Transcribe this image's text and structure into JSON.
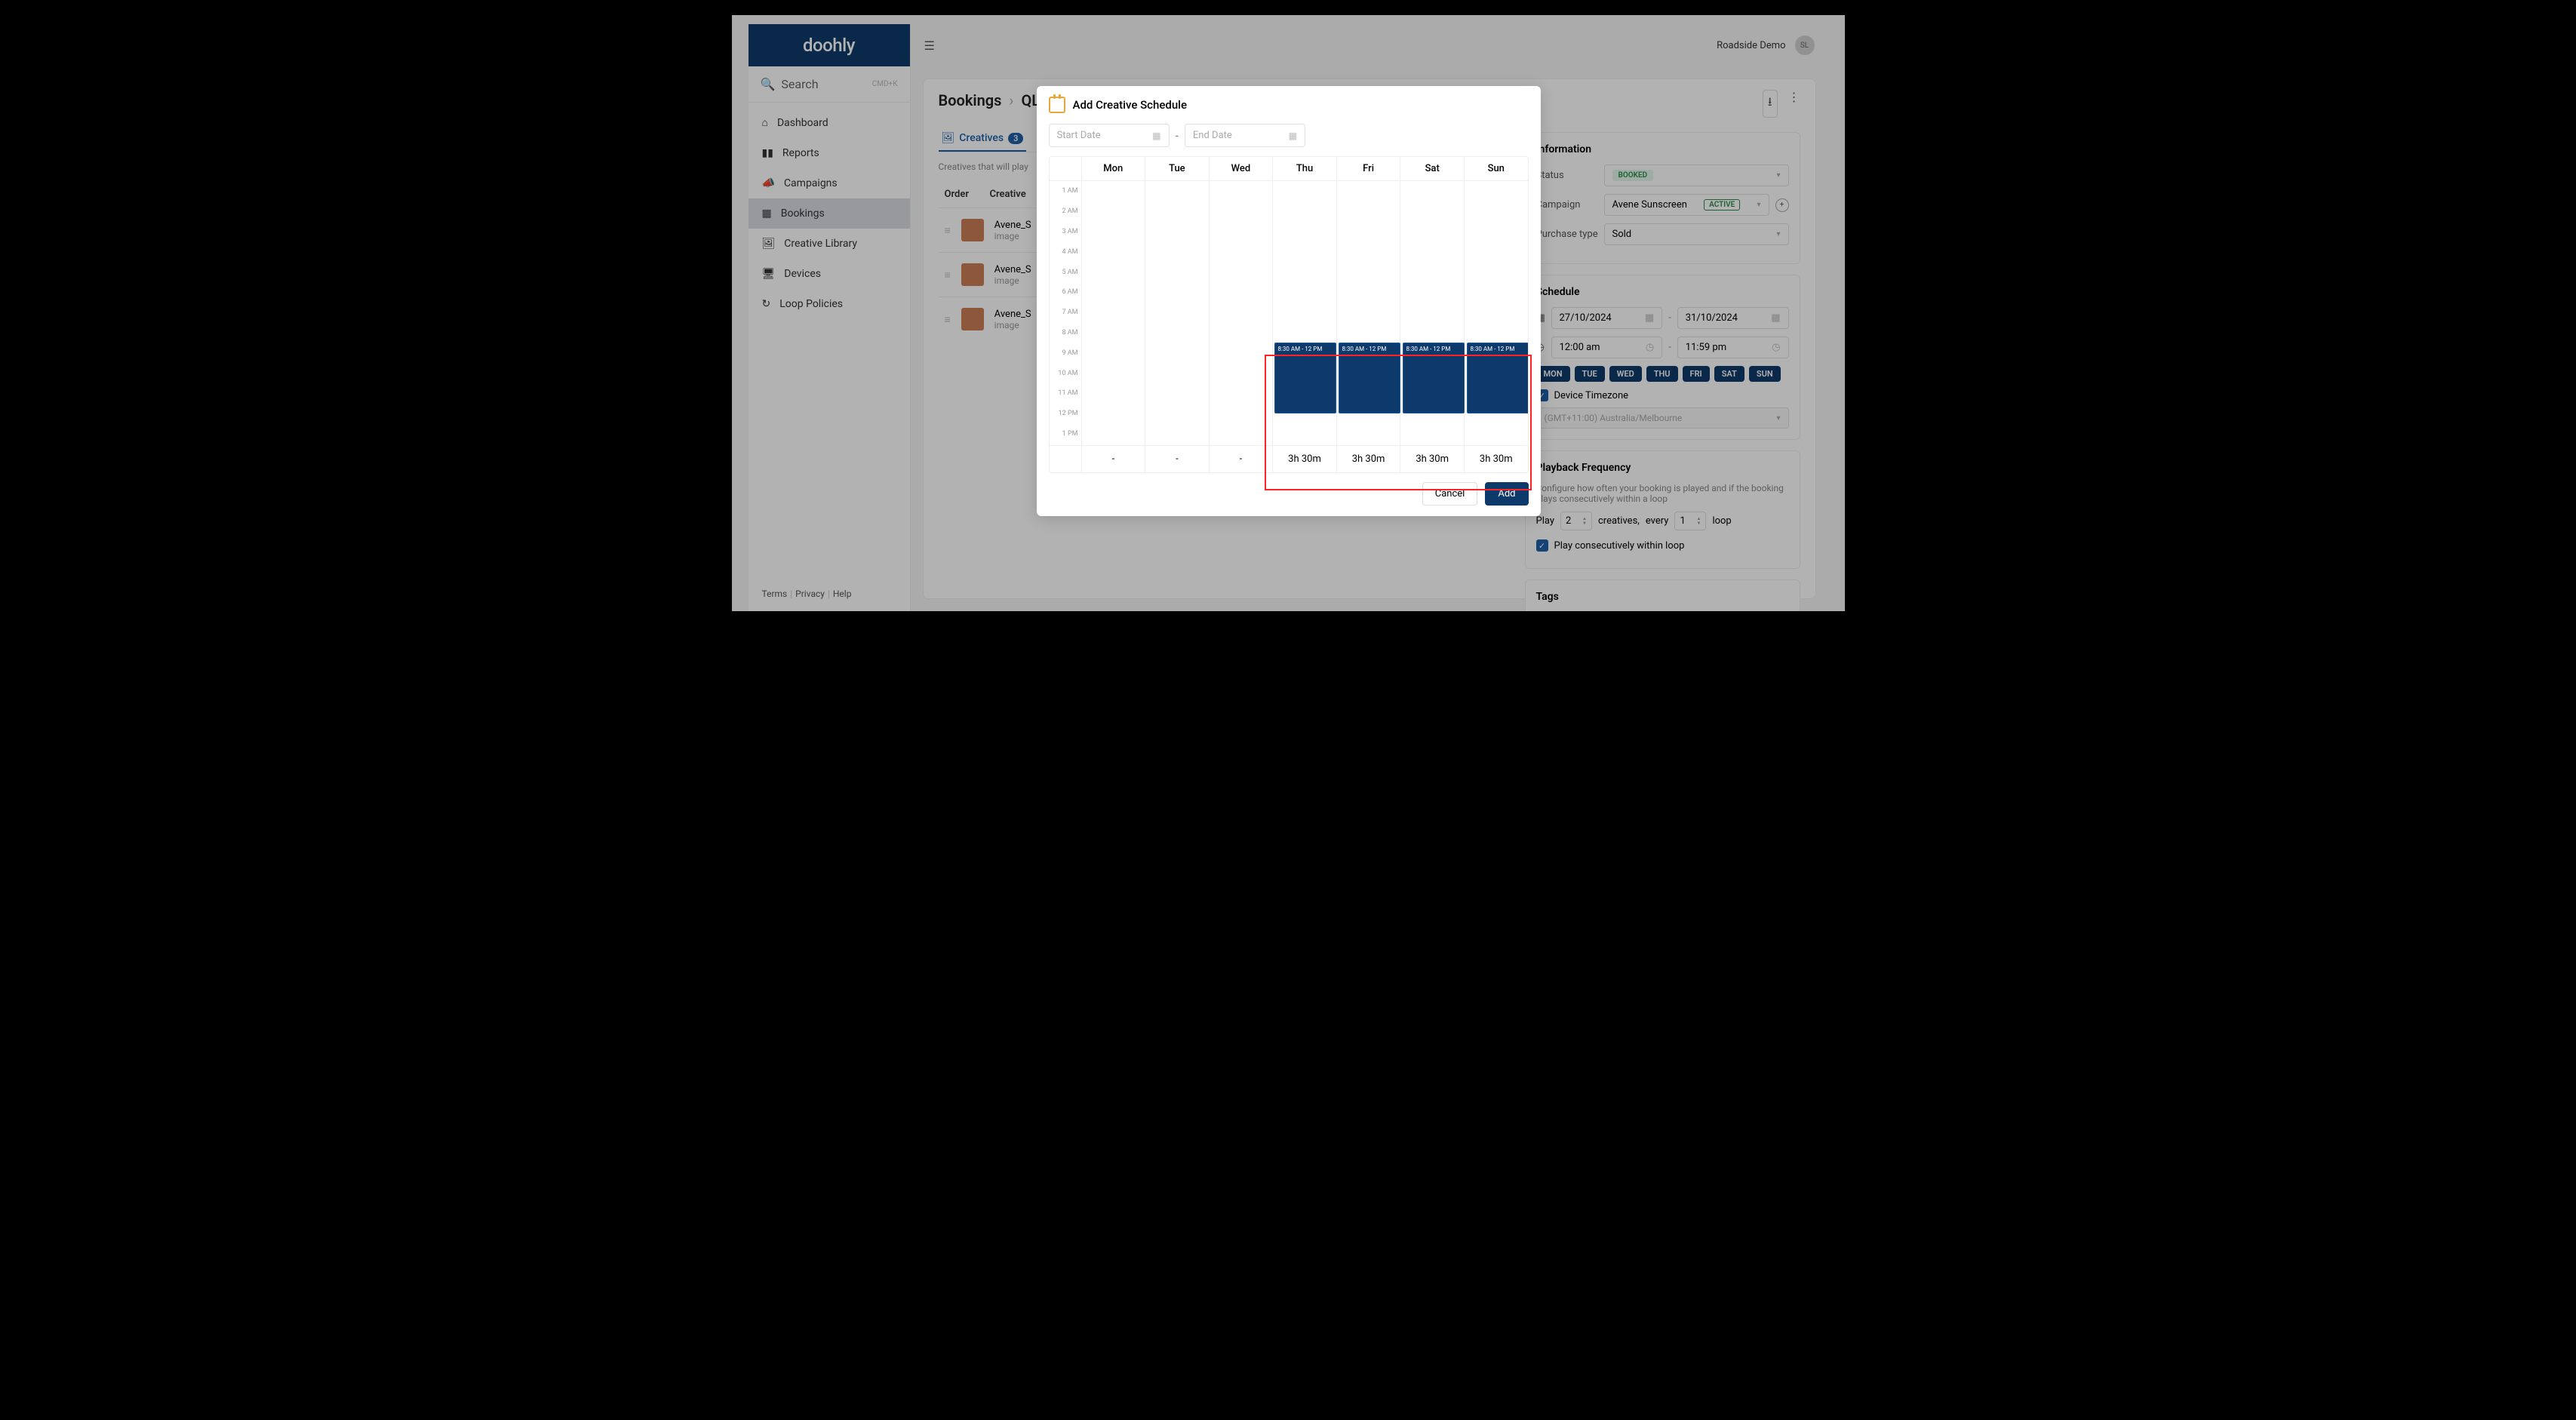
{
  "logo": "doohly",
  "search": {
    "placeholder": "Search",
    "shortcut": "CMD+K"
  },
  "nav": [
    {
      "label": "Dashboard",
      "icon": "⌂"
    },
    {
      "label": "Reports",
      "icon": "📊"
    },
    {
      "label": "Campaigns",
      "icon": "📣"
    },
    {
      "label": "Bookings",
      "icon": "📅",
      "active": true
    },
    {
      "label": "Creative Library",
      "icon": "🖼"
    },
    {
      "label": "Devices",
      "icon": "🖥"
    },
    {
      "label": "Loop Policies",
      "icon": "↻"
    }
  ],
  "footer": [
    "Terms",
    "Privacy",
    "Help"
  ],
  "topbar": {
    "account": "Roadside Demo",
    "avatar": "SL"
  },
  "breadcrumb": {
    "root": "Bookings",
    "page": "QLD"
  },
  "tabs": {
    "active": "Creatives",
    "count": "3"
  },
  "subtext": "Creatives that will play",
  "table": {
    "col1": "Order",
    "col2": "Creative"
  },
  "creatives": [
    {
      "name": "Avene_S",
      "type": "image"
    },
    {
      "name": "Avene_S",
      "type": "image"
    },
    {
      "name": "Avene_S",
      "type": "image"
    }
  ],
  "info": {
    "title": "Information",
    "status_label": "Status",
    "status_value": "BOOKED",
    "campaign_label": "Campaign",
    "campaign_value": "Avene Sunscreen",
    "campaign_badge": "ACTIVE",
    "purchase_label": "Purchase type",
    "purchase_value": "Sold"
  },
  "schedule": {
    "title": "Schedule",
    "start_date": "27/10/2024",
    "end_date": "31/10/2024",
    "start_time": "12:00 am",
    "end_time": "11:59 pm",
    "days": [
      "MON",
      "TUE",
      "WED",
      "THU",
      "FRI",
      "SAT",
      "SUN"
    ],
    "device_tz_label": "Device Timezone",
    "tz": "(GMT+11:00) Australia/Melbourne"
  },
  "frequency": {
    "title": "Playback Frequency",
    "desc": "Configure how often your booking is played and if the booking plays consecutively within a loop",
    "play": "Play",
    "play_val": "2",
    "creatives": "creatives,",
    "every": "every",
    "every_val": "1",
    "loop": "loop",
    "consec": "Play consecutively within loop"
  },
  "tags": {
    "title": "Tags"
  },
  "modal": {
    "title": "Add Creative Schedule",
    "start_placeholder": "Start Date",
    "end_placeholder": "End Date",
    "days": [
      "Mon",
      "Tue",
      "Wed",
      "Thu",
      "Fri",
      "Sat",
      "Sun"
    ],
    "hours": [
      "1 AM",
      "2 AM",
      "3 AM",
      "4 AM",
      "5 AM",
      "6 AM",
      "7 AM",
      "8 AM",
      "9 AM",
      "10 AM",
      "11 AM",
      "12 PM",
      "1 PM"
    ],
    "block_label": "8:30 AM - 12 PM",
    "totals": [
      "-",
      "-",
      "-",
      "3h 30m",
      "3h 30m",
      "3h 30m",
      "3h 30m"
    ],
    "cancel": "Cancel",
    "add": "Add"
  }
}
